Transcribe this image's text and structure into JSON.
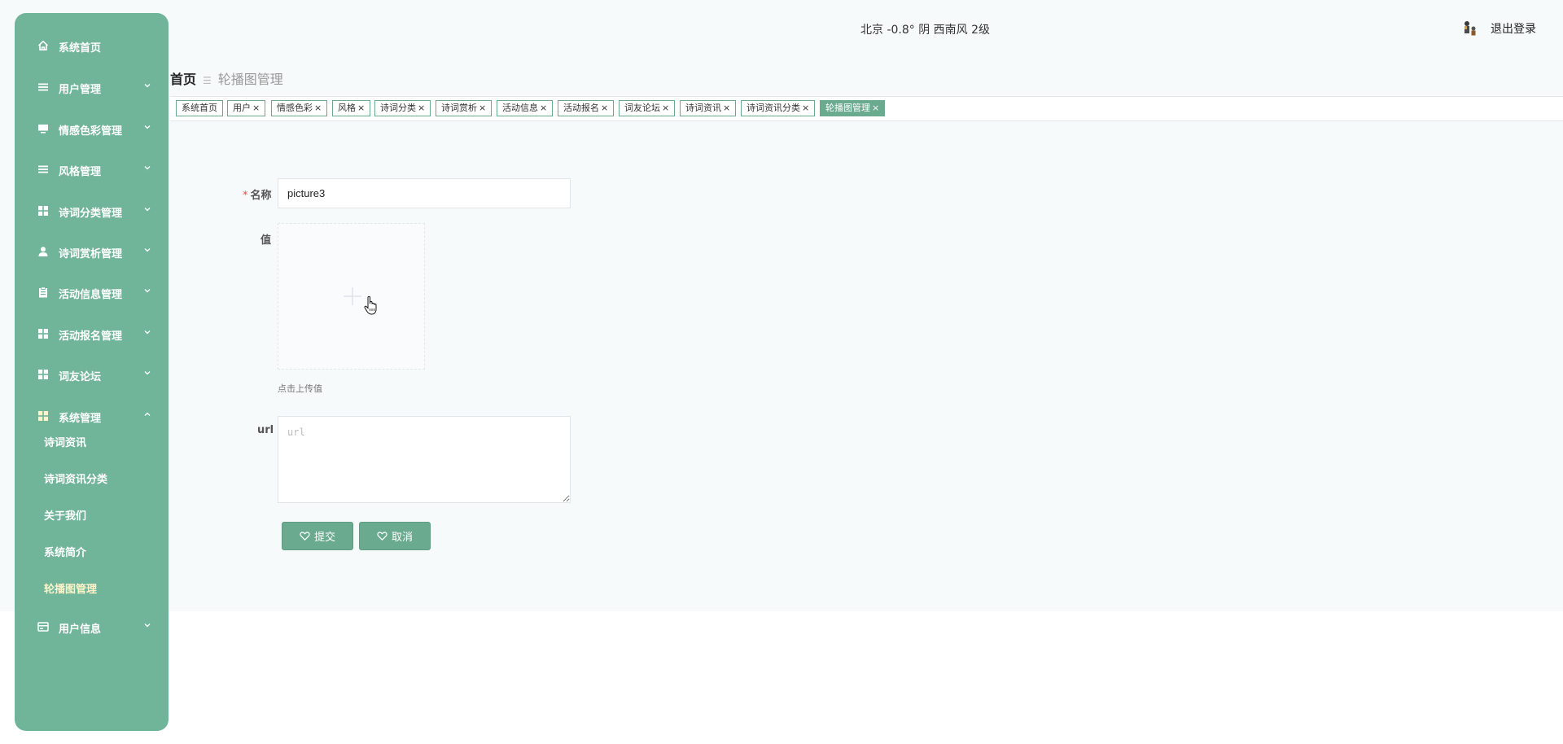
{
  "header": {
    "weather": "北京  -0.8°  阴  西南风  2级",
    "logout_label": "退出登录"
  },
  "sidebar": {
    "items": [
      {
        "label": "系统首页",
        "icon": "home-icon"
      },
      {
        "label": "用户管理",
        "icon": "list-icon"
      },
      {
        "label": "情感色彩管理",
        "icon": "monitor-icon"
      },
      {
        "label": "风格管理",
        "icon": "list-icon"
      },
      {
        "label": "诗词分类管理",
        "icon": "grid-icon"
      },
      {
        "label": "诗词赏析管理",
        "icon": "user-icon"
      },
      {
        "label": "活动信息管理",
        "icon": "clipboard-icon"
      },
      {
        "label": "活动报名管理",
        "icon": "grid-icon"
      },
      {
        "label": "词友论坛",
        "icon": "grid-icon"
      },
      {
        "label": "系统管理",
        "icon": "grid-icon"
      },
      {
        "label": "用户信息",
        "icon": "card-icon"
      }
    ],
    "system_sub": [
      "诗词资讯",
      "诗词资讯分类",
      "关于我们",
      "系统简介",
      "轮播图管理"
    ]
  },
  "breadcrumb": {
    "home": "首页",
    "current": "轮播图管理"
  },
  "tags": [
    {
      "label": "系统首页",
      "closable": false
    },
    {
      "label": "用户",
      "closable": true
    },
    {
      "label": "情感色彩",
      "closable": true
    },
    {
      "label": "风格",
      "closable": true
    },
    {
      "label": "诗词分类",
      "closable": true
    },
    {
      "label": "诗词赏析",
      "closable": true
    },
    {
      "label": "活动信息",
      "closable": true
    },
    {
      "label": "活动报名",
      "closable": true
    },
    {
      "label": "词友论坛",
      "closable": true
    },
    {
      "label": "诗词资讯",
      "closable": true
    },
    {
      "label": "诗词资讯分类",
      "closable": true
    },
    {
      "label": "轮播图管理",
      "closable": true,
      "active": true
    }
  ],
  "form": {
    "name_label": "名称",
    "name_value": "picture3",
    "value_label": "值",
    "upload_hint": "点击上传值",
    "url_label": "url",
    "url_placeholder": "url",
    "submit_label": "提交",
    "cancel_label": "取消"
  },
  "colors": {
    "accent": "#6aaa8f",
    "sidebar_bg": "#70b49a",
    "active_sub": "#fff3c9",
    "required": "#e64a4a"
  }
}
